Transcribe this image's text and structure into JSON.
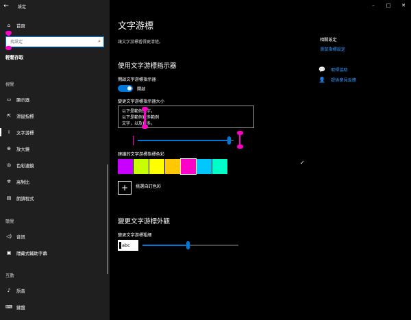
{
  "window": {
    "title": "設定",
    "back_icon": "back-arrow-icon",
    "controls": [
      "–",
      "□",
      "✕"
    ]
  },
  "sidebar": {
    "home_label": "首頁",
    "search_placeholder": "找設定",
    "search_value": "",
    "easy_access_heading": "輕鬆存取",
    "section_vision": "視覺",
    "section_hearing": "聽覺",
    "section_interaction": "互動",
    "items": [
      {
        "label": "顯示器",
        "icon": "monitor-icon"
      },
      {
        "label": "滑鼠指標",
        "icon": "mouse-pointer-icon"
      },
      {
        "label": "文字游標",
        "icon": "text-cursor-icon"
      },
      {
        "label": "放大鏡",
        "icon": "magnifier-icon"
      },
      {
        "label": "色彩濾鏡",
        "icon": "color-filter-icon"
      },
      {
        "label": "高對比",
        "icon": "high-contrast-icon"
      },
      {
        "label": "朗讀程式",
        "icon": "narrator-icon"
      },
      {
        "label": "音訊",
        "icon": "audio-icon"
      },
      {
        "label": "隱藏式輔助字幕",
        "icon": "closed-captions-icon"
      },
      {
        "label": "語音",
        "icon": "microphone-icon"
      },
      {
        "label": "鍵盤",
        "icon": "keyboard-icon"
      }
    ]
  },
  "main": {
    "title": "文字游標",
    "description": "讓文字游標看得更清楚。",
    "indicator_heading": "使用文字游標指示器",
    "indicator_toggle_label": "開啟文字游標指示器",
    "indicator_toggle_state": "開啟",
    "size_label": "變更文字游標指示器大小",
    "preview_lines": [
      "以下是範例文字，",
      "以下是範例更多範例",
      "文字，以及更多。"
    ],
    "size_slider_value": 0.95,
    "color_label": "建議的文字游標指標色彩",
    "colors": [
      "#c800ff",
      "#c8ff00",
      "#ffff00",
      "#ffc800",
      "#ff00c8",
      "#00c8ff",
      "#00ffc8"
    ],
    "selected_color_index": 4,
    "custom_color_label": "挑選自訂色彩",
    "appearance_heading": "變更文字游標外觀",
    "thickness_label": "變更文字游標粗細",
    "thickness_sample": "abc",
    "thickness_slider_value": 0.47
  },
  "related": {
    "title": "相關設定",
    "link": "滑鼠指標設定",
    "help": "取得協助",
    "feedback": "提供意見反應"
  },
  "accent_color": "#0078d7",
  "indicator_color": "#ff00c8"
}
